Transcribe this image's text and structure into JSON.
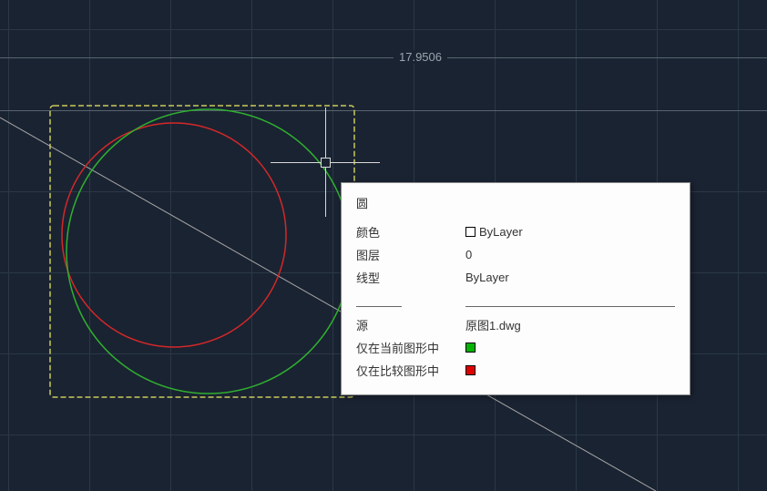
{
  "dimension": {
    "value": "17.9506"
  },
  "tooltip": {
    "title": "圆",
    "rows": {
      "color_label": "颜色",
      "color_value": "ByLayer",
      "layer_label": "图层",
      "layer_value": "0",
      "linetype_label": "线型",
      "linetype_value": "ByLayer",
      "source_label": "源",
      "source_value": "原图1.dwg",
      "only_current_label": "仅在当前图形中",
      "only_compare_label": "仅在比较图形中"
    }
  }
}
